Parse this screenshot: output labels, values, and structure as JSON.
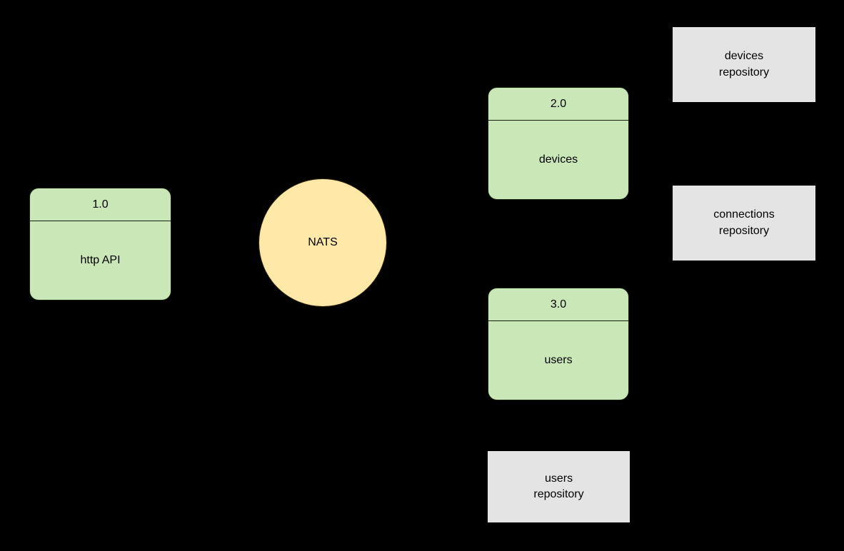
{
  "diagram": {
    "type": "data-flow-diagram",
    "background_color": "#000000",
    "colors": {
      "process_fill": "#c9e7b7",
      "process_stroke": "#15210d",
      "store_fill": "#e4e4e4",
      "broker_fill": "#ffe8a8",
      "broker_stroke": "#2a2208",
      "text": "#000000"
    },
    "processes": [
      {
        "id": "1.0",
        "label": "http API"
      },
      {
        "id": "2.0",
        "label": "devices"
      },
      {
        "id": "3.0",
        "label": "users"
      }
    ],
    "broker": {
      "label": "NATS"
    },
    "stores": [
      {
        "label": "devices\nrepository"
      },
      {
        "label": "connections\nrepository"
      },
      {
        "label": "users\nrepository"
      }
    ]
  }
}
